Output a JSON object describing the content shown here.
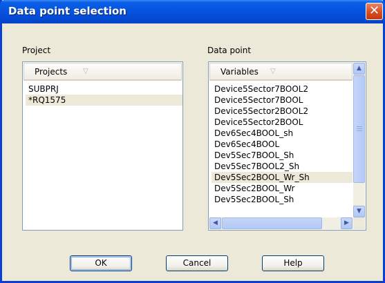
{
  "window": {
    "title": "Data point selection",
    "close_glyph": "✕"
  },
  "project": {
    "label": "Project",
    "header": "Projects",
    "items": [
      "SUBPRJ",
      "*RQ1575"
    ],
    "selected_index": 1
  },
  "datapoint": {
    "label": "Data point",
    "header": "Variables",
    "items": [
      "Device5Sector7BOOL2",
      "Device5Sector7BOOL",
      "Device5Sector2BOOL2",
      "Device5Sector2BOOL",
      "Dev6Sec4BOOL_sh",
      "Dev6Sec4BOOL",
      "Dev5Sec7BOOL_Sh",
      "Dev5Sec7BOOL2_Sh",
      "Dev5Sec2BOOL_Wr_Sh",
      "Dev5Sec2BOOL_Wr",
      "Dev5Sec2BOOL_Sh"
    ],
    "selected_index": 8
  },
  "buttons": {
    "ok": "OK",
    "cancel": "Cancel",
    "help": "Help"
  },
  "icons": {
    "sort": "sort-triangle-icon",
    "scroll_up": "chevron-up-icon",
    "scroll_down": "chevron-down-icon",
    "scroll_left": "chevron-left-icon",
    "scroll_right": "chevron-right-icon"
  }
}
